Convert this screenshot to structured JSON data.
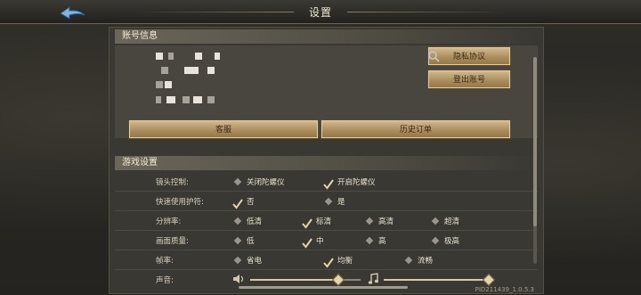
{
  "header": {
    "title": "设置"
  },
  "account": {
    "section_title": "账号信息",
    "privacy_label": "隐私协议",
    "logout_label": "登出账号",
    "service_label": "客服",
    "orders_label": "历史订单"
  },
  "game": {
    "section_title": "游戏设置",
    "rows": [
      {
        "label": "镜头控制:",
        "options": [
          {
            "text": "关闭陀螺仪",
            "selected": false
          },
          {
            "text": "开启陀螺仪",
            "selected": true
          }
        ]
      },
      {
        "label": "快速使用护符:",
        "options": [
          {
            "text": "否",
            "selected": true
          },
          {
            "text": "是",
            "selected": false
          }
        ]
      },
      {
        "label": "分辨率:",
        "options": [
          {
            "text": "低清",
            "selected": false
          },
          {
            "text": "标清",
            "selected": true
          },
          {
            "text": "高清",
            "selected": false
          },
          {
            "text": "超清",
            "selected": false
          }
        ]
      },
      {
        "label": "画面质量:",
        "options": [
          {
            "text": "低",
            "selected": false
          },
          {
            "text": "中",
            "selected": true
          },
          {
            "text": "高",
            "selected": false
          },
          {
            "text": "极高",
            "selected": false
          }
        ]
      },
      {
        "label": "帧率:",
        "options": [
          {
            "text": "省电",
            "selected": false
          },
          {
            "text": "均衡",
            "selected": true
          },
          {
            "text": "流畅",
            "selected": false
          }
        ]
      }
    ],
    "sound": {
      "label": "声音:",
      "sfx_level": 0.8,
      "music_level": 1.0
    }
  },
  "footer": {
    "version": "PID211439_1.0.5.3"
  }
}
